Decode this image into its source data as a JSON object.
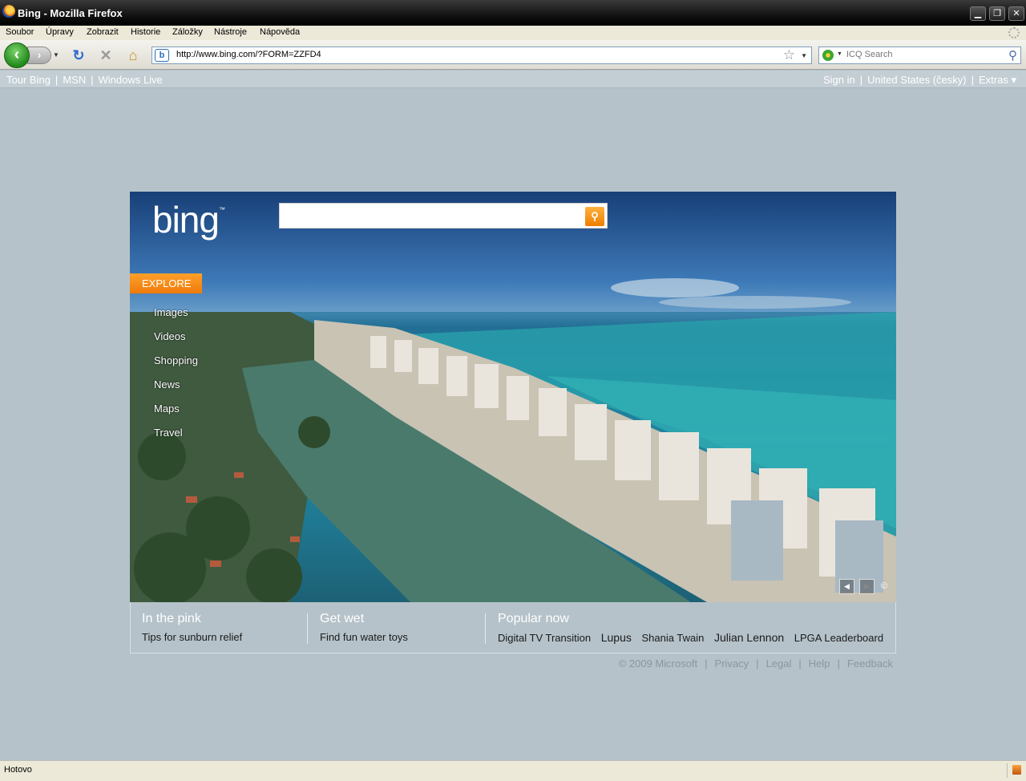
{
  "window": {
    "title": "Bing - Mozilla Firefox",
    "buttons": {
      "minimize": "▁",
      "restore": "❐",
      "close": "✕"
    }
  },
  "menu": [
    "Soubor",
    "Úpravy",
    "Zobrazit",
    "Historie",
    "Záložky",
    "Nástroje",
    "Nápověda"
  ],
  "toolbar": {
    "back": "‹",
    "forward": "›",
    "reload": "↻",
    "stop": "✕",
    "home": "⌂",
    "url": "http://www.bing.com/?FORM=ZZFD4",
    "favicon": "b",
    "bookmark_star": "☆",
    "search_placeholder": "ICQ Search",
    "search_icon": "⚲"
  },
  "bing": {
    "topnav_left": [
      "Tour Bing",
      "MSN",
      "Windows Live"
    ],
    "topnav_right": [
      "Sign in",
      "United States  (česky)",
      "Extras ▾"
    ],
    "logo": "bing",
    "logo_tm": "™",
    "search_go": "⚲",
    "explore": "EXPLORE",
    "explore_links": [
      "Images",
      "Videos",
      "Shopping",
      "News",
      "Maps",
      "Travel"
    ],
    "hero_prev": "◀",
    "hero_next": "▶",
    "hero_info": "©",
    "columns": [
      {
        "heading": "In the pink",
        "links": [
          "Tips for sunburn relief"
        ]
      },
      {
        "heading": "Get wet",
        "links": [
          "Find fun water toys"
        ]
      },
      {
        "heading": "Popular now",
        "links": [
          "Digital TV Transition",
          "Lupus",
          "Shania Twain",
          "Julian Lennon",
          "LPGA Leaderboard"
        ]
      }
    ],
    "footer": [
      "© 2009 Microsoft",
      "Privacy",
      "Legal",
      "Help",
      "Feedback"
    ]
  },
  "status": {
    "text": "Hotovo"
  },
  "colors": {
    "accent": "#f39019",
    "page_bg": "#b5c2c9"
  }
}
